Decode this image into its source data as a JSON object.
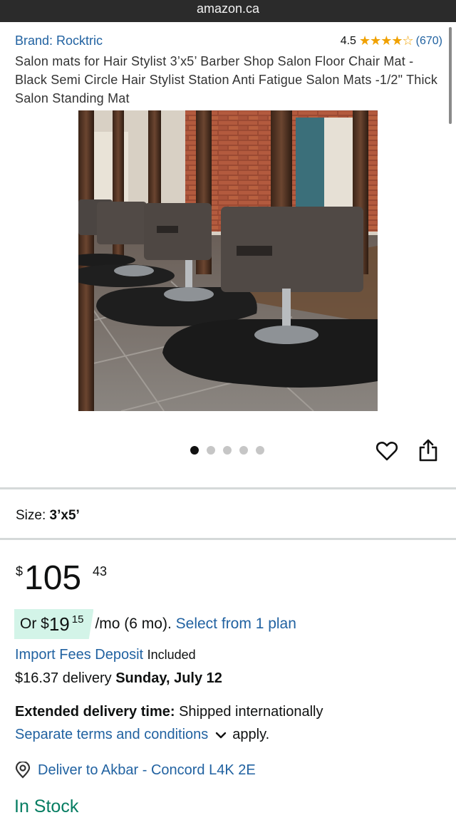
{
  "browser": {
    "domain": "amazon.ca"
  },
  "product": {
    "brand": "Brand: Rocktric",
    "rating": "4.5",
    "stars": "★★★★☆",
    "reviews": "(670)",
    "title": "Salon mats for Hair Stylist 3’x5’ Barber Shop Salon Floor Chair Mat -Black Semi Circle Hair Stylist Station Anti Fatigue Salon Mats -1/2\" Thick Salon Standing Mat",
    "image": {
      "icon": "product-photo",
      "gallery_count": 5,
      "active_index": 0
    }
  },
  "size": {
    "label": "Size:",
    "value": "3’x5’"
  },
  "price": {
    "symbol": "$",
    "whole": "105",
    "fraction": "43"
  },
  "installment": {
    "prefix": "Or $",
    "amount_whole": "19",
    "amount_fraction": "15",
    "term": "/mo (6 mo).",
    "link": "Select from 1 plan"
  },
  "fees": {
    "link": "Import Fees Deposit",
    "status": "Included"
  },
  "delivery": {
    "cost": "$16.37 delivery",
    "date": "Sunday, July 12"
  },
  "extended": {
    "label": "Extended delivery time:",
    "text": "Shipped internationally",
    "terms_link": "Separate terms and conditions",
    "terms_suffix": "apply."
  },
  "deliver_to": {
    "text": "Deliver to Akbar - Concord L4K 2E"
  },
  "stock": {
    "status": "In Stock"
  },
  "colors": {
    "link": "#2162a1",
    "star": "#f0a100",
    "stock": "#067d62",
    "badge": "#d3f4e8"
  }
}
